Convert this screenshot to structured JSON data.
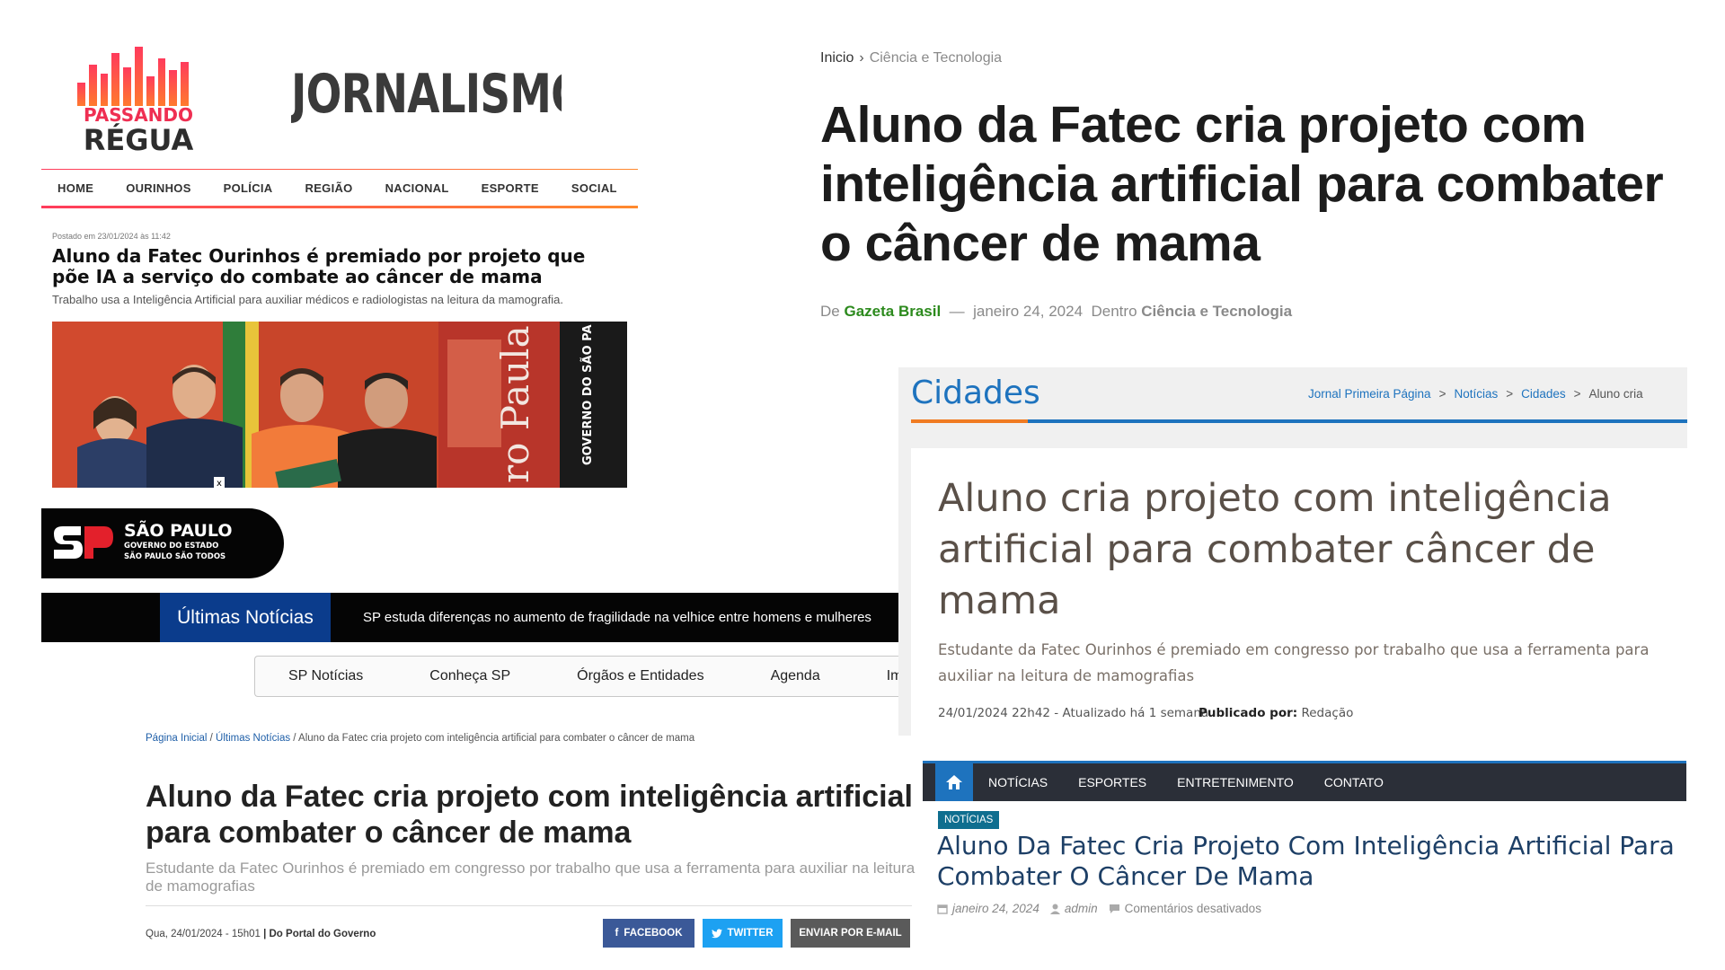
{
  "passando": {
    "logo_line1": "PASSANDO",
    "logo_line2": "RÉGUA",
    "banner": "JORNALISMO DE VI",
    "nav": [
      "HOME",
      "OURINHOS",
      "POLÍCIA",
      "REGIÃO",
      "NACIONAL",
      "ESPORTE",
      "SOCIAL"
    ],
    "posted": "Postado em 23/01/2024 às 11:42",
    "title": "Aluno da Fatec Ourinhos é premiado por projeto que põe IA a serviço do combate ao câncer de mama",
    "subtitle": "Trabalho usa a Inteligência Artificial para auxiliar médicos e radiologistas na leitura da mamografia.",
    "photo_wall_text": "ro Paula So",
    "photo_sign_text": "GOVERNO DO SÃO PA",
    "photo_close": "x",
    "accent_pink": "#ff3b5c",
    "accent_orange": "#ff8a2e"
  },
  "gazeta": {
    "breadcrumb_home": "Inicio",
    "breadcrumb_current": "Ciência e Tecnologia",
    "title": "Aluno da Fatec cria projeto com inteligência artificial para combater o câncer de mama",
    "meta_by": "De",
    "meta_author": "Gazeta Brasil",
    "meta_dash": "—",
    "meta_date": "janeiro 24, 2024",
    "meta_in": "Dentro",
    "meta_category": "Ciência e Tecnologia",
    "author_color": "#2c8a1d"
  },
  "saopaulo": {
    "badge_name": "SÃO PAULO",
    "badge_sub1": "GOVERNO DO ESTADO",
    "badge_sub2": "SÃO PAULO SÃO TODOS",
    "ticker_label": "Últimas Notícias",
    "ticker_text": "SP estuda diferenças no aumento de fragilidade na velhice entre homens e mulheres",
    "nav": [
      "SP Notícias",
      "Conheça SP",
      "Órgãos e Entidades",
      "Agenda",
      "Impre"
    ],
    "crumb_home": "Página Inicial",
    "crumb_sep": "/",
    "crumb_section": "Últimas Notícias",
    "crumb_current": "/ Aluno da Fatec cria projeto com inteligência artificial para combater o câncer de mama",
    "title": "Aluno da Fatec cria projeto com inteligência artificial para combater o câncer de mama",
    "subtitle": "Estudante da Fatec Ourinhos é premiado em congresso por trabalho que usa a ferramenta para auxiliar na leitura de mamografias",
    "date": "Qua, 24/01/2024 - 15h01",
    "source": "| Do Portal do Governo",
    "btn_facebook": "FACEBOOK",
    "btn_twitter": "TWITTER",
    "btn_email": "ENVIAR POR E-MAIL",
    "brand_blue": "#0b3c8c"
  },
  "primeira": {
    "section": "Cidades",
    "crumbs": [
      "Jornal Primeira Página",
      "Notícias",
      "Cidades"
    ],
    "crumb_sep": ">",
    "crumb_current": "Aluno cria",
    "title": "Aluno cria projeto com inteligência artificial para combater câncer de mama",
    "subtitle": "Estudante da Fatec Ourinhos é premiado em congresso por trabalho que usa a ferramenta para auxiliar na leitura de mamografias",
    "date": "24/01/2024 22h42 - Atualizado há 1 semana",
    "published_label": "Publicado por:",
    "published_by": "Redação",
    "link_color": "#1e73be"
  },
  "site_e": {
    "nav": [
      "NOTÍCIAS",
      "ESPORTES",
      "ENTRETENIMENTO",
      "CONTATO"
    ],
    "tag": "NOTÍCIAS",
    "title": "Aluno Da Fatec Cria Projeto Com Inteligência Artificial Para Combater O Câncer De Mama",
    "date": "janeiro 24, 2024",
    "author": "admin",
    "comments": "Comentários desativados",
    "icons": [
      "home-icon",
      "calendar-icon",
      "user-icon",
      "comment-icon"
    ]
  }
}
